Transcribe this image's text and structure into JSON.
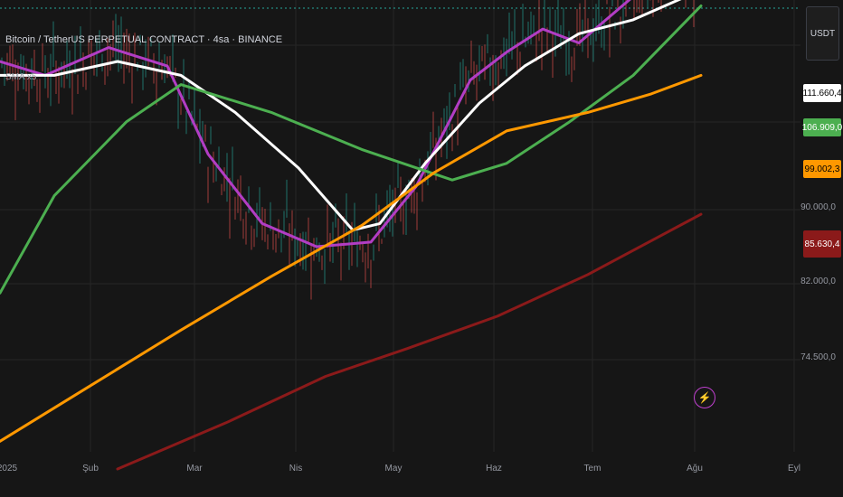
{
  "header": {
    "title": "Bitcoin / TetherUS PERPETUAL CONTRACT · 4sa · BINANCE",
    "indicator_label": "SMA x5",
    "currency": "USDT"
  },
  "colors": {
    "background": "#161616",
    "grid": "#262626",
    "candle_up": "#26a69a",
    "candle_down": "#ef5350",
    "sma_purple": "#b23dc4",
    "sma_white": "#ffffff",
    "sma_green": "#4caf50",
    "sma_orange": "#ff9800",
    "sma_red": "#8b1a1a"
  },
  "chart_data": {
    "type": "line",
    "title": "Bitcoin / TetherUS PERPETUAL CONTRACT · 4sa · BINANCE",
    "x_tick_labels": [
      "2025",
      "Şub",
      "Mar",
      "Nis",
      "May",
      "Haz",
      "Tem",
      "Ağu",
      "Eyl"
    ],
    "y_tick_labels": [
      "90.000,0",
      "82.000,0",
      "74.500,0"
    ],
    "price_tags": [
      {
        "label": "111.660,4",
        "value": 111660.4,
        "color": "#ffffff",
        "text_color": "#000000"
      },
      {
        "label": "106.909,0",
        "value": 106909.0,
        "color": "#4caf50",
        "text_color": "#ffffff"
      },
      {
        "label": "99.002,3",
        "value": 99002.3,
        "color": "#ff9800",
        "text_color": "#000000"
      },
      {
        "label": "85.630,4",
        "value": 85630.4,
        "color": "#8b1a1a",
        "text_color": "#ffffff"
      }
    ],
    "series": [
      {
        "color": "#b23dc4",
        "points": [
          [
            0,
            106000
          ],
          [
            50,
            104500
          ],
          [
            120,
            107500
          ],
          [
            185,
            105500
          ],
          [
            230,
            96000
          ],
          [
            290,
            88500
          ],
          [
            350,
            86000
          ],
          [
            410,
            86500
          ],
          [
            460,
            92500
          ],
          [
            520,
            104000
          ],
          [
            560,
            107000
          ],
          [
            600,
            109500
          ],
          [
            640,
            108000
          ],
          [
            700,
            113000
          ],
          [
            740,
            116500
          ],
          [
            770,
            115000
          ]
        ]
      },
      {
        "color": "#ffffff",
        "points": [
          [
            0,
            104500
          ],
          [
            60,
            104500
          ],
          [
            130,
            106000
          ],
          [
            200,
            104500
          ],
          [
            260,
            100500
          ],
          [
            330,
            94500
          ],
          [
            390,
            87800
          ],
          [
            420,
            88500
          ],
          [
            470,
            95000
          ],
          [
            530,
            101500
          ],
          [
            580,
            105500
          ],
          [
            640,
            109000
          ],
          [
            700,
            110500
          ],
          [
            770,
            113500
          ]
        ]
      },
      {
        "color": "#4caf50",
        "points": [
          [
            0,
            81000
          ],
          [
            60,
            91500
          ],
          [
            140,
            99500
          ],
          [
            200,
            103500
          ],
          [
            300,
            100500
          ],
          [
            400,
            96500
          ],
          [
            500,
            93200
          ],
          [
            560,
            95000
          ],
          [
            630,
            99500
          ],
          [
            700,
            104500
          ],
          [
            775,
            112000
          ]
        ]
      },
      {
        "color": "#ff9800",
        "points": [
          [
            0,
            65000
          ],
          [
            100,
            71000
          ],
          [
            200,
            77000
          ],
          [
            300,
            82800
          ],
          [
            400,
            88300
          ],
          [
            480,
            94000
          ],
          [
            560,
            98500
          ],
          [
            650,
            100500
          ],
          [
            720,
            102500
          ],
          [
            775,
            104500
          ]
        ]
      },
      {
        "color": "#8b1a1a",
        "points": [
          [
            130,
            62000
          ],
          [
            250,
            67000
          ],
          [
            360,
            72000
          ],
          [
            450,
            75000
          ],
          [
            550,
            78500
          ],
          [
            650,
            83000
          ],
          [
            775,
            89500
          ]
        ]
      }
    ],
    "price_low_marker": 74500,
    "grid": true
  },
  "footer": {
    "bolt_icon": "lightning-icon"
  }
}
